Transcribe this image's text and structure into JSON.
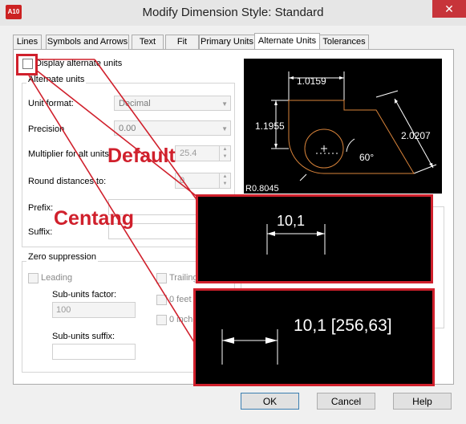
{
  "window": {
    "title": "Modify Dimension Style: Standard",
    "app_icon_text": "A10",
    "close_label": "✕"
  },
  "tabs": [
    "Lines",
    "Symbols and Arrows",
    "Text",
    "Fit",
    "Primary Units",
    "Alternate Units",
    "Tolerances"
  ],
  "active_tab": "Alternate Units",
  "display_alternate_units": {
    "label": "Display alternate units",
    "checked": false
  },
  "alternate_units": {
    "group_title": "Alternate units",
    "unit_format_label": "Unit format:",
    "unit_format_value": "Decimal",
    "precision_label": "Precision",
    "precision_value": "0.00",
    "multiplier_label": "Multiplier for alt units:",
    "multiplier_value": "25.4",
    "round_label": "Round distances to:",
    "round_value": "0",
    "prefix_label": "Prefix:",
    "suffix_label": "Suffix:"
  },
  "zero_suppression": {
    "group_title": "Zero suppression",
    "leading_label": "Leading",
    "trailing_label": "Trailing",
    "sub_units_factor_label": "Sub-units factor:",
    "sub_units_factor_value": "100",
    "sub_units_suffix_label": "Sub-units suffix:",
    "zero_feet_label": "0 feet",
    "zero_inches_label": "0 inches"
  },
  "preview": {
    "dim_top": "1.0159",
    "dim_left": "1.1955",
    "dim_right": "2.0207",
    "angle": "60°",
    "radius": "R0.8045"
  },
  "annotations": {
    "default_label": "Default",
    "checked_label": "Centang",
    "default_example": "10,1",
    "checked_example": "10,1 [256,63]"
  },
  "buttons": {
    "ok": "OK",
    "cancel": "Cancel",
    "help": "Help"
  }
}
